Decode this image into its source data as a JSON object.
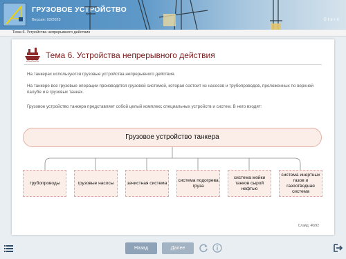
{
  "header": {
    "title": "ГРУЗОВОЕ УСТРОЙСТВО",
    "version": "Версия: 02/2023",
    "brand": "Stern"
  },
  "breadcrumb": "Тема 6. Устройства непрерывного действия",
  "slide": {
    "title": "Тема 6. Устройства непрерывного действия",
    "paragraphs": [
      "На танкерах используются грузовые устройства непрерывного действия.",
      "На танкере все грузовые операции производятся грузовой системой, которая состоит из насосов и трубопроводов, проложенных по верхней палубе и в грузовых танках.",
      "Грузовое устройство танкера представляет собой целый комплекс специальных устройств и систем. В него входят:"
    ],
    "diagram": {
      "root": "Грузовое устройство танкера",
      "children": [
        "трубопроводы",
        "грузовые насосы",
        "зачистная система",
        "система подогрева груза",
        "система мойки танков сырой нефтью",
        "система инертных газов и газоотводная система"
      ]
    },
    "slide_number": "Слайд: 40/92"
  },
  "nav": {
    "back_label": "Назад",
    "next_label": "Далее"
  },
  "icons": [
    "menu-icon",
    "reload-icon",
    "info-icon",
    "exit-icon",
    "tanker-icon"
  ],
  "colors": {
    "accent": "#7a1d1d",
    "header": "#4f8cc0",
    "button": "#8fa3b8",
    "box_fill": "#fbeee8"
  }
}
